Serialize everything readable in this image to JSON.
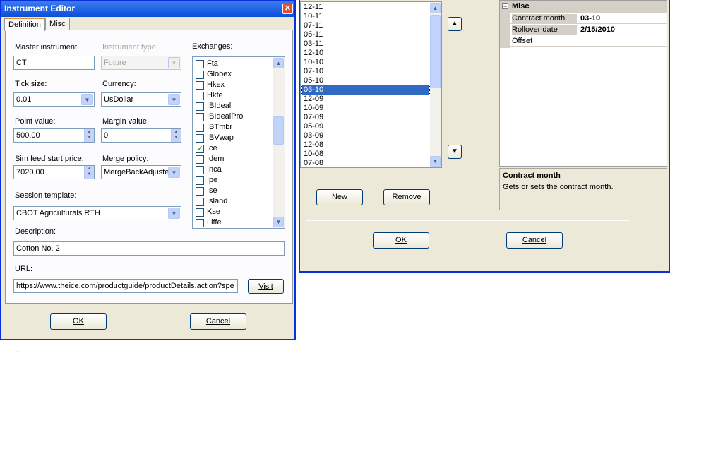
{
  "dialog": {
    "title": "Instrument Editor",
    "tabs": [
      "Definition",
      "Misc"
    ],
    "fields": {
      "master_instrument_label": "Master instrument:",
      "master_instrument_value": "CT",
      "instrument_type_label": "Instrument type:",
      "instrument_type_value": "Future",
      "tick_size_label": "Tick size:",
      "tick_size_value": "0.01",
      "currency_label": "Currency:",
      "currency_value": "UsDollar",
      "point_value_label": "Point value:",
      "point_value_value": "500.00",
      "margin_value_label": "Margin value:",
      "margin_value_value": "0",
      "sim_feed_label": "Sim feed start price:",
      "sim_feed_value": "7020.00",
      "merge_policy_label": "Merge policy:",
      "merge_policy_value": "MergeBackAdjuste",
      "session_template_label": "Session template:",
      "session_template_value": "CBOT Agriculturals RTH",
      "description_label": "Description:",
      "description_value": "Cotton No. 2",
      "url_label": "URL:",
      "url_value": "https://www.theice.com/productguide/productDetails.action?spe"
    },
    "exchanges_label": "Exchanges:",
    "exchanges": [
      {
        "name": "Fta",
        "checked": false
      },
      {
        "name": "Globex",
        "checked": false
      },
      {
        "name": "Hkex",
        "checked": false
      },
      {
        "name": "Hkfe",
        "checked": false
      },
      {
        "name": "IBIdeal",
        "checked": false
      },
      {
        "name": "IBIdealPro",
        "checked": false
      },
      {
        "name": "IBTmbr",
        "checked": false
      },
      {
        "name": "IBVwap",
        "checked": false
      },
      {
        "name": "Ice",
        "checked": true
      },
      {
        "name": "Idem",
        "checked": false
      },
      {
        "name": "Inca",
        "checked": false
      },
      {
        "name": "Ipe",
        "checked": false
      },
      {
        "name": "Ise",
        "checked": false
      },
      {
        "name": "Island",
        "checked": false
      },
      {
        "name": "Kse",
        "checked": false
      },
      {
        "name": "Liffe",
        "checked": false
      }
    ],
    "buttons": {
      "visit": "Visit",
      "ok": "OK",
      "cancel": "Cancel"
    }
  },
  "rollover_panel": {
    "months": [
      "12-11",
      "10-11",
      "07-11",
      "05-11",
      "03-11",
      "12-10",
      "10-10",
      "07-10",
      "05-10",
      "03-10",
      "12-09",
      "10-09",
      "07-09",
      "05-09",
      "03-09",
      "12-08",
      "10-08",
      "07-08"
    ],
    "selected_month": "03-10",
    "buttons": {
      "new": "New",
      "remove": "Remove",
      "ok": "OK",
      "cancel": "Cancel"
    },
    "property_grid": {
      "category": "Misc",
      "rows": [
        {
          "name": "Contract month",
          "value": "03-10"
        },
        {
          "name": "Rollover date",
          "value": "2/15/2010"
        },
        {
          "name": "Offset",
          "value": ""
        }
      ]
    },
    "description": {
      "title": "Contract month",
      "text": "Gets or sets the contract month."
    }
  },
  "stray_dot": "."
}
